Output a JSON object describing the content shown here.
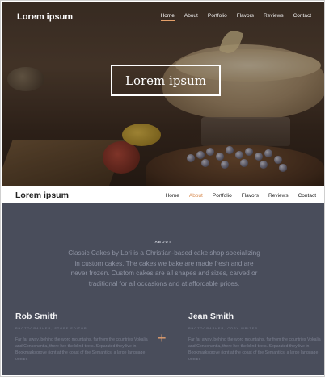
{
  "hero": {
    "brand": "Lorem ipsum",
    "nav": [
      {
        "label": "Home",
        "active": true
      },
      {
        "label": "About",
        "active": false
      },
      {
        "label": "Portfolio",
        "active": false
      },
      {
        "label": "Flavors",
        "active": false
      },
      {
        "label": "Reviews",
        "active": false
      },
      {
        "label": "Contact",
        "active": false
      }
    ],
    "title": "Lorem ipsum"
  },
  "sticky_nav": {
    "brand": "Lorem ipsum",
    "nav": [
      {
        "label": "Home",
        "active": false
      },
      {
        "label": "About",
        "active": true
      },
      {
        "label": "Portfolio",
        "active": false
      },
      {
        "label": "Flavors",
        "active": false
      },
      {
        "label": "Reviews",
        "active": false
      },
      {
        "label": "Contact",
        "active": false
      }
    ]
  },
  "about": {
    "label": "ABOUT",
    "text": "Classic Cakes by Lori is a Christian-based cake shop specializing in custom cakes. The cakes we bake are made fresh and are never frozen. Custom cakes are all shapes and sizes, carved or traditional for all occasions and at affordable prices.",
    "people": [
      {
        "name": "Rob Smith",
        "role": "PHOTOGRAPHER, STORE EDITOR",
        "bio": "Far far away, behind the word mountains, far from the countries Vokalia and Consonantia, there live the blind texts. Separated they live in Bookmarksgrove right at the coast of the Semantics, a large language ocean."
      },
      {
        "name": "Jean Smith",
        "role": "PHOTOGRAPHER, COPY WRITER",
        "bio": "Far far away, behind the word mountains, far from the countries Vokalia and Consonantia, there live the blind texts. Separated they live in Bookmarksgrove right at the coast of the Semantics, a large language ocean."
      }
    ],
    "separator": "+"
  },
  "colors": {
    "accent": "#e3a06f",
    "about_bg": "#494d5b"
  }
}
